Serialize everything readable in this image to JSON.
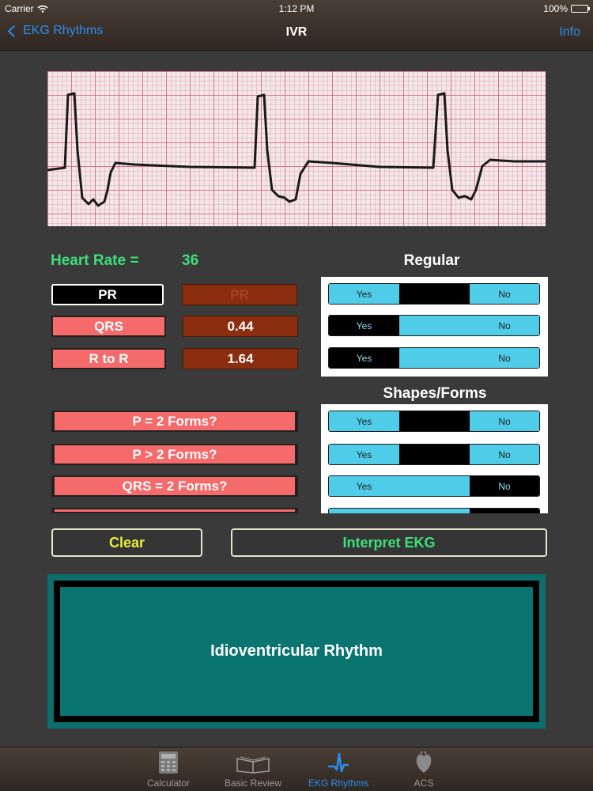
{
  "status_bar": {
    "carrier": "Carrier",
    "time": "1:12 PM",
    "battery": "100%"
  },
  "nav": {
    "back_label": "EKG Rhythms",
    "title": "IVR",
    "info_label": "Info"
  },
  "heart_rate": {
    "label": "Heart Rate =",
    "value": "36"
  },
  "intervals": {
    "pr": {
      "label": "PR",
      "value": "PR"
    },
    "qrs": {
      "label": "QRS",
      "value": "0.44"
    },
    "rr": {
      "label": "R to R",
      "value": "1.64"
    }
  },
  "regular": {
    "title": "Regular",
    "rows": [
      {
        "yes": "Yes",
        "no": "No",
        "selected": "none"
      },
      {
        "yes": "Yes",
        "no": "No",
        "selected": "no"
      },
      {
        "yes": "Yes",
        "no": "No",
        "selected": "no"
      }
    ]
  },
  "shapes": {
    "title": "Shapes/Forms",
    "items": [
      {
        "label": "P = 2 Forms?",
        "yes": "Yes",
        "no": "No"
      },
      {
        "label": "P > 2 Forms?",
        "yes": "Yes",
        "no": "No"
      },
      {
        "label": "QRS = 2 Forms?",
        "yes": "Yes",
        "no": "No"
      }
    ]
  },
  "actions": {
    "clear": "Clear",
    "interpret": "Interpret EKG"
  },
  "result": {
    "text": "Idioventricular Rhythm"
  },
  "tabs": [
    {
      "label": "Calculator",
      "icon": "calculator-icon",
      "active": false
    },
    {
      "label": "Basic Review",
      "icon": "book-icon",
      "active": false
    },
    {
      "label": "EKG Rhythms",
      "icon": "ekg-wave-icon",
      "active": true
    },
    {
      "label": "ACS",
      "icon": "heart-icon",
      "active": false
    }
  ],
  "colors": {
    "accent_blue": "#2b8cf0",
    "green_text": "#3ce07a",
    "label_red": "#f56a6a",
    "toggle_on": "#4fcde8",
    "result_teal": "#0a7470"
  }
}
